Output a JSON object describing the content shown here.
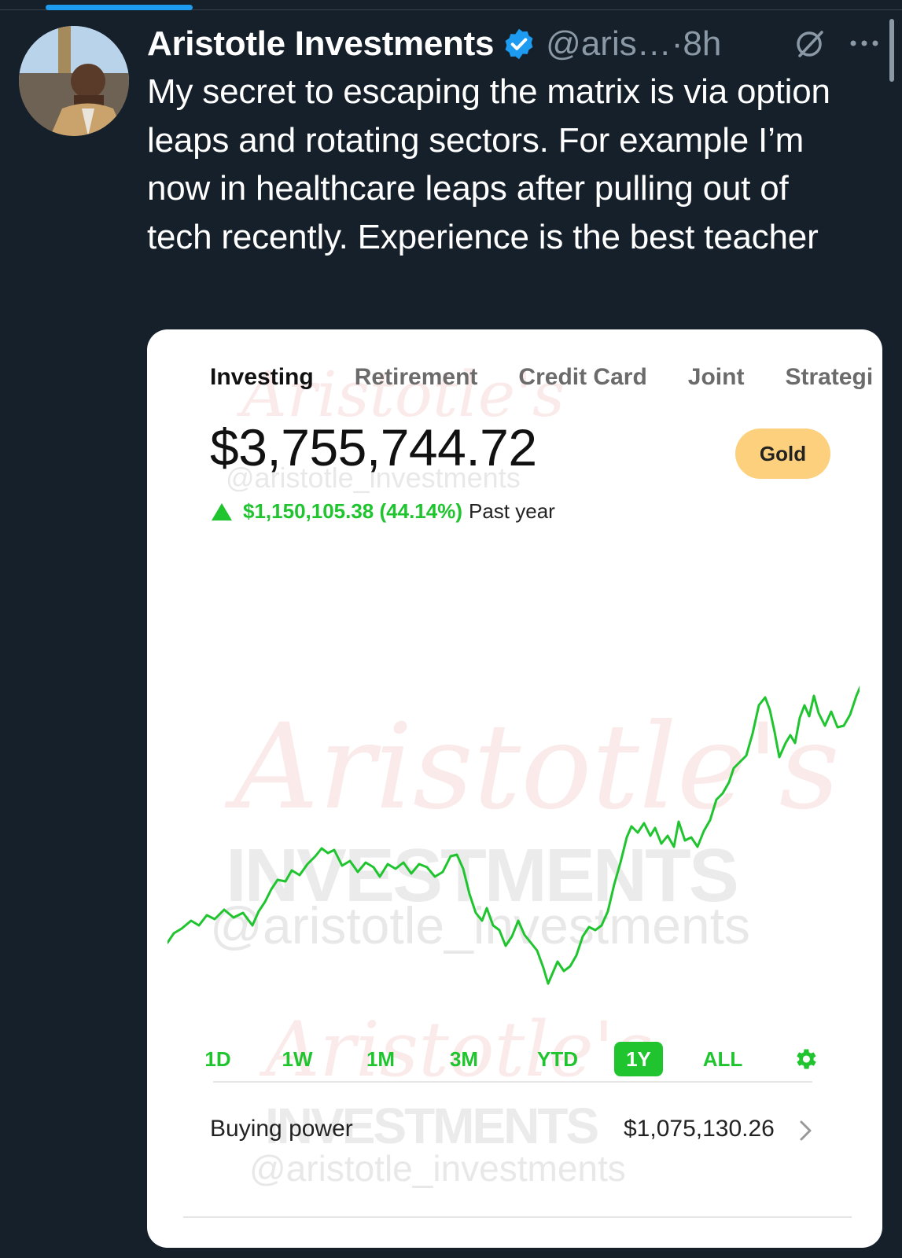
{
  "tweet": {
    "author_name": "Aristotle Investments",
    "handle": "@aris…",
    "separator": "·",
    "time": "8h",
    "text": "My secret to escaping the matrix is via option leaps and rotating sectors. For example I’m now in healthcare leaps after pulling out of tech recently. Experience is the best teacher",
    "icons": [
      "verified-badge-icon",
      "grok-icon",
      "more-icon"
    ]
  },
  "card": {
    "account_tabs": [
      "Investing",
      "Retirement",
      "Credit Card",
      "Joint",
      "Strategi"
    ],
    "active_tab": "Investing",
    "balance": "$3,755,744.72",
    "gold_label": "Gold",
    "gain": "$1,150,105.38 (44.14%)",
    "gain_period": "Past year",
    "ranges": [
      "1D",
      "1W",
      "1M",
      "3M",
      "YTD",
      "1Y",
      "ALL"
    ],
    "active_range": "1Y",
    "buying_power_label": "Buying power",
    "buying_power_value": "$1,075,130.26",
    "watermark": {
      "script": "Aristotle's",
      "block": "INVESTMENTS",
      "handle": "@aristotle_investments"
    }
  },
  "colors": {
    "background": "#15202b",
    "accent_blue": "#1d9bf0",
    "chart_green": "#1fc42f",
    "gold": "#fcd07c"
  }
}
